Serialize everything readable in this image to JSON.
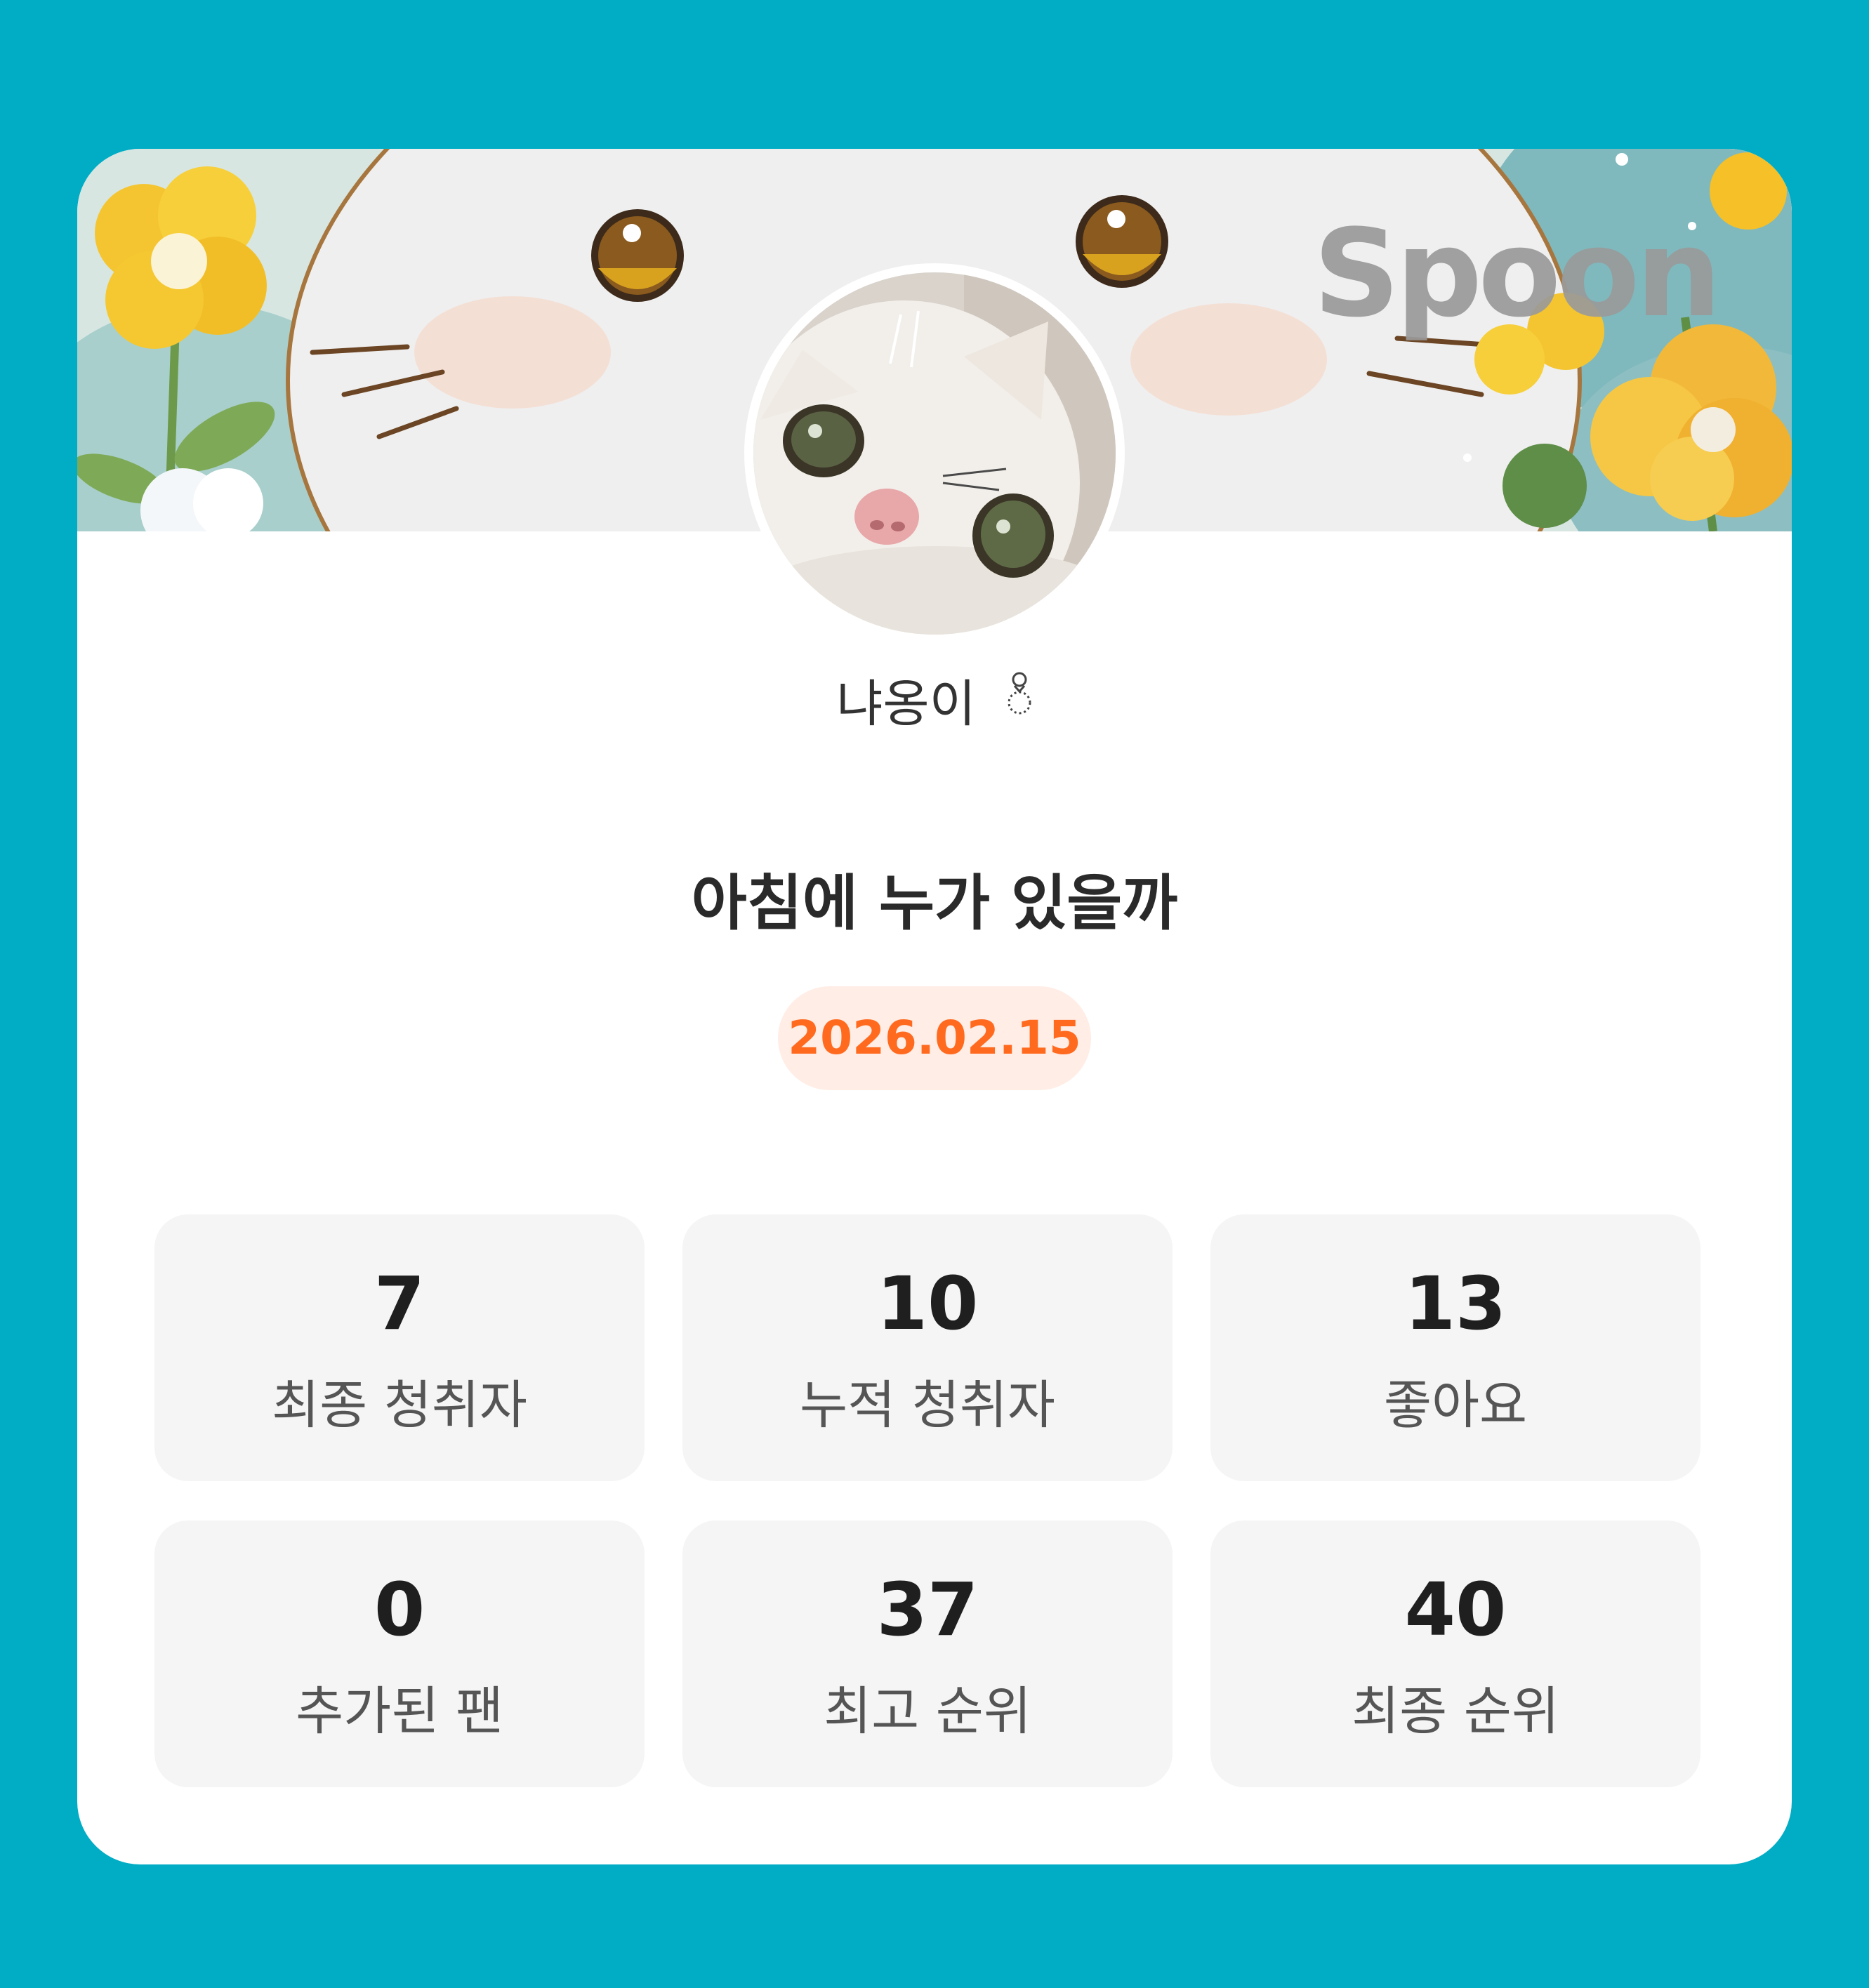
{
  "brand": {
    "logo_text": "Spoon"
  },
  "profile": {
    "nickname": "냐옹이",
    "badge_icon": "ring-icon",
    "avatar_icon": "cat-avatar"
  },
  "broadcast": {
    "title": "아침에 누가 있을까",
    "date": "2026.02.15"
  },
  "stats": [
    {
      "value": "7",
      "label": "최종 청취자"
    },
    {
      "value": "10",
      "label": "누적 청취자"
    },
    {
      "value": "13",
      "label": "좋아요"
    },
    {
      "value": "0",
      "label": "추가된 팬"
    },
    {
      "value": "37",
      "label": "최고 순위"
    },
    {
      "value": "40",
      "label": "최종 순위"
    }
  ],
  "colors": {
    "background": "#00ADC5",
    "card": "#FFFFFF",
    "date_text": "#FF6A1F",
    "date_pill": "#FFEDE6",
    "stat_tile": "#F5F5F5"
  }
}
